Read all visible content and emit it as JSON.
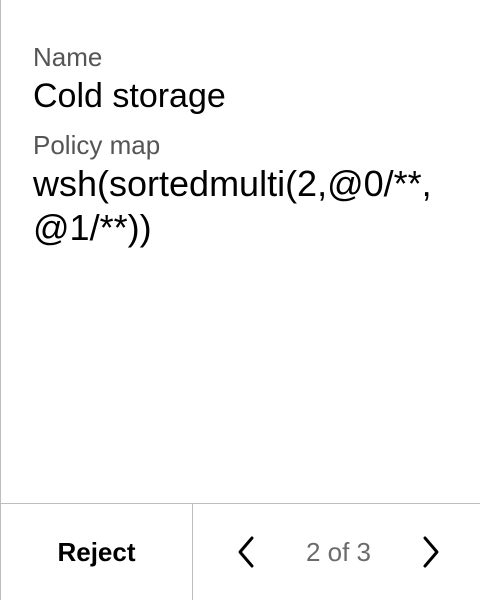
{
  "details": {
    "name_label": "Name",
    "name_value": "Cold storage",
    "policy_label": "Policy map",
    "policy_value": "wsh(sortedmulti(2,@0/**,@1/**))"
  },
  "footer": {
    "reject_label": "Reject",
    "page_indicator": "2 of 3",
    "prev_icon": "chevron-left-icon",
    "next_icon": "chevron-right-icon"
  }
}
